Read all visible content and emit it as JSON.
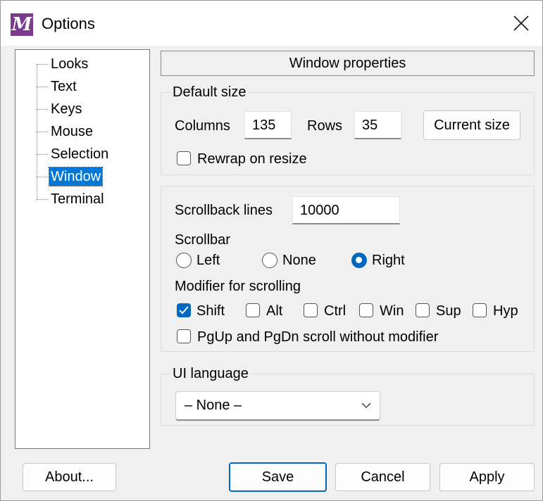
{
  "window": {
    "title": "Options",
    "icon_letter": "M",
    "close_glyph": "×"
  },
  "tree": {
    "items": [
      {
        "label": "Looks",
        "selected": false
      },
      {
        "label": "Text",
        "selected": false
      },
      {
        "label": "Keys",
        "selected": false
      },
      {
        "label": "Mouse",
        "selected": false
      },
      {
        "label": "Selection",
        "selected": false
      },
      {
        "label": "Window",
        "selected": true
      },
      {
        "label": "Terminal",
        "selected": false
      }
    ]
  },
  "panel": {
    "header": "Window properties",
    "default_size": {
      "group_label": "Default size",
      "columns_label": "Columns",
      "columns_value": "135",
      "rows_label": "Rows",
      "rows_value": "35",
      "current_size_button": "Current size",
      "rewrap_label": "Rewrap on resize",
      "rewrap_checked": false
    },
    "scroll": {
      "scrollback_label": "Scrollback lines",
      "scrollback_value": "10000",
      "scrollbar_label": "Scrollbar",
      "scrollbar_options": [
        {
          "label": "Left",
          "checked": false
        },
        {
          "label": "None",
          "checked": false
        },
        {
          "label": "Right",
          "checked": true
        }
      ],
      "modifier_label": "Modifier for scrolling",
      "modifiers": [
        {
          "label": "Shift",
          "checked": true
        },
        {
          "label": "Alt",
          "checked": false
        },
        {
          "label": "Ctrl",
          "checked": false
        },
        {
          "label": "Win",
          "checked": false
        },
        {
          "label": "Sup",
          "checked": false
        },
        {
          "label": "Hyp",
          "checked": false
        }
      ],
      "pgup_label": "PgUp and PgDn scroll without modifier",
      "pgup_checked": false
    },
    "language": {
      "group_label": "UI language",
      "selected": "– None –"
    }
  },
  "buttons": {
    "about": "About...",
    "save": "Save",
    "cancel": "Cancel",
    "apply": "Apply"
  },
  "colors": {
    "accent": "#0067c0",
    "selection": "#0078d7",
    "app_icon": "#7a3b8f"
  }
}
